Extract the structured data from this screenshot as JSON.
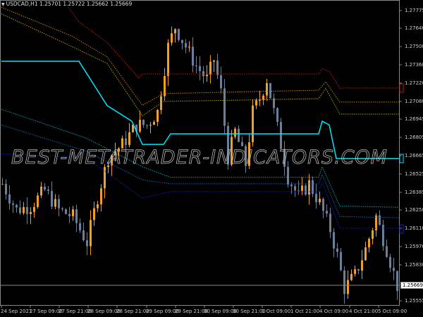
{
  "header": {
    "symbol": "USDCAD,H1",
    "open": "1.25701",
    "high": "1.25722",
    "low": "1.25662",
    "close": "1.25669"
  },
  "price_axis": [
    "1.27775",
    "1.27640",
    "1.27500",
    "1.27360",
    "1.27220",
    "1.27080",
    "1.26945",
    "1.26805",
    "1.26665",
    "1.26525",
    "1.26385",
    "1.26250",
    "1.26110",
    "1.25970",
    "1.25830",
    "1.25555"
  ],
  "current_price": "1.25669",
  "time_axis": [
    "24 Sep 2021",
    "27 Sep 09:00",
    "27 Sep 21:00",
    "28 Sep 09:00",
    "28 Sep 21:00",
    "29 Sep 09:00",
    "29 Sep 21:00",
    "30 Sep 09:00",
    "30 Sep 21:00",
    "1 Oct 09:00",
    "1 Oct 21:00",
    "4 Oct 09:00",
    "4 Oct 21:00",
    "5 Oct 09:00"
  ],
  "watermark": "BEST-METATRADER-INDICATORS.COM",
  "colors": {
    "bull": "#f0a020",
    "bear": "#6a7f99",
    "main_line": "#00e5ff",
    "red": "#c01818",
    "orange": "#c08010",
    "yellow": "#b0a000",
    "teal": "#10a0b0",
    "blue": "#1060c0",
    "navy": "#1020b0"
  },
  "price_path": [
    [
      0,
      1.2645
    ],
    [
      4,
      1.2625
    ],
    [
      8,
      1.2628
    ],
    [
      12,
      1.264
    ],
    [
      16,
      1.2625
    ],
    [
      20,
      1.262
    ],
    [
      24,
      1.26
    ],
    [
      27,
      1.2635
    ],
    [
      30,
      1.2665
    ],
    [
      34,
      1.2675
    ],
    [
      38,
      1.269
    ],
    [
      41,
      1.269
    ],
    [
      44,
      1.27
    ],
    [
      47,
      1.275
    ],
    [
      49,
      1.2765
    ],
    [
      52,
      1.275
    ],
    [
      55,
      1.2735
    ],
    [
      58,
      1.2725
    ],
    [
      60,
      1.274
    ],
    [
      62,
      1.2715
    ],
    [
      64,
      1.2665
    ],
    [
      66,
      1.2685
    ],
    [
      69,
      1.266
    ],
    [
      71,
      1.27
    ],
    [
      73,
      1.271
    ],
    [
      75,
      1.2725
    ],
    [
      77,
      1.27
    ],
    [
      79,
      1.2675
    ],
    [
      81,
      1.265
    ],
    [
      84,
      1.2635
    ],
    [
      87,
      1.2645
    ],
    [
      90,
      1.263
    ],
    [
      93,
      1.261
    ],
    [
      95,
      1.259
    ],
    [
      97,
      1.2565
    ],
    [
      100,
      1.2575
    ],
    [
      103,
      1.2595
    ],
    [
      106,
      1.262
    ],
    [
      109,
      1.2595
    ],
    [
      112,
      1.2567
    ]
  ],
  "indicator_lines": {
    "main": [
      [
        0,
        1.27387
      ],
      [
        22,
        1.27387
      ],
      [
        30,
        1.27048
      ],
      [
        37,
        1.26929
      ],
      [
        40,
        1.26751
      ],
      [
        46,
        1.26751
      ],
      [
        48,
        1.26832
      ],
      [
        90,
        1.26832
      ],
      [
        91,
        1.26929
      ],
      [
        93,
        1.269
      ],
      [
        95,
        1.26643
      ],
      [
        113,
        1.26643
      ]
    ],
    "red": [
      [
        19,
        1.278
      ],
      [
        22,
        1.2769
      ],
      [
        30,
        1.2753
      ],
      [
        39,
        1.2726
      ],
      [
        40,
        1.2729
      ],
      [
        90,
        1.2729
      ],
      [
        91,
        1.2733
      ],
      [
        93,
        1.2731
      ],
      [
        96,
        1.27182
      ],
      [
        113,
        1.27182
      ]
    ],
    "orange": [
      [
        0,
        1.278
      ],
      [
        20,
        1.2758
      ],
      [
        30,
        1.2742
      ],
      [
        40,
        1.2705
      ],
      [
        46,
        1.2714
      ],
      [
        90,
        1.27166
      ],
      [
        92,
        1.2723
      ],
      [
        96,
        1.27075
      ],
      [
        113,
        1.27075
      ]
    ],
    "yellow": [
      [
        0,
        1.2775
      ],
      [
        20,
        1.275
      ],
      [
        30,
        1.2737
      ],
      [
        40,
        1.2697
      ],
      [
        46,
        1.2708
      ],
      [
        90,
        1.27101
      ],
      [
        92,
        1.2718
      ],
      [
        96,
        1.26983
      ],
      [
        113,
        1.26983
      ]
    ],
    "teal": [
      [
        0,
        1.2702
      ],
      [
        24,
        1.268
      ],
      [
        40,
        1.2658
      ],
      [
        48,
        1.265
      ],
      [
        90,
        1.265
      ],
      [
        91,
        1.2658
      ],
      [
        96,
        1.2628
      ],
      [
        113,
        1.2627
      ]
    ],
    "blue": [
      [
        0,
        1.269
      ],
      [
        24,
        1.267
      ],
      [
        40,
        1.2648
      ],
      [
        48,
        1.2645
      ],
      [
        90,
        1.2645
      ],
      [
        91,
        1.2652
      ],
      [
        96,
        1.262
      ],
      [
        113,
        1.2619
      ]
    ],
    "navy": [
      [
        0,
        1.2668
      ],
      [
        24,
        1.2665
      ],
      [
        40,
        1.2634
      ],
      [
        48,
        1.2639
      ],
      [
        90,
        1.2639
      ],
      [
        91,
        1.2646
      ],
      [
        96,
        1.2611
      ],
      [
        113,
        1.2611
      ]
    ]
  }
}
